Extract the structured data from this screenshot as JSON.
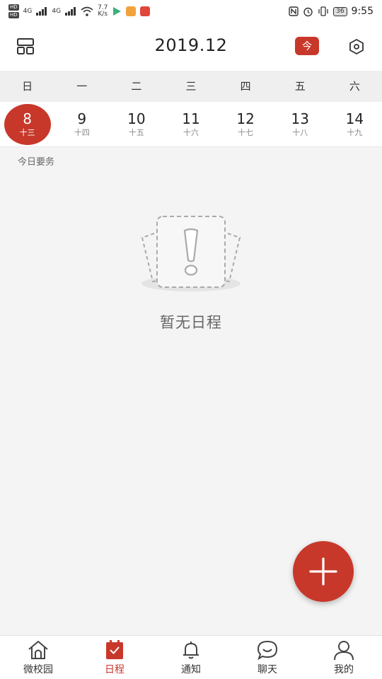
{
  "status_bar": {
    "hd_top": "HD",
    "hd_bottom": "HD",
    "net1": "4G",
    "net2": "4G",
    "speed_value": "7.7",
    "speed_unit": "K/s",
    "battery": "36",
    "time": "9:55"
  },
  "header": {
    "title": "2019.12",
    "today_label": "今"
  },
  "weekdays": [
    "日",
    "一",
    "二",
    "三",
    "四",
    "五",
    "六"
  ],
  "dates": [
    {
      "day": "8",
      "lunar": "十三",
      "selected": true
    },
    {
      "day": "9",
      "lunar": "十四",
      "selected": false
    },
    {
      "day": "10",
      "lunar": "十五",
      "selected": false
    },
    {
      "day": "11",
      "lunar": "十六",
      "selected": false
    },
    {
      "day": "12",
      "lunar": "十七",
      "selected": false
    },
    {
      "day": "13",
      "lunar": "十八",
      "selected": false
    },
    {
      "day": "14",
      "lunar": "十九",
      "selected": false
    }
  ],
  "main": {
    "section_label": "今日要务",
    "empty_text": "暂无日程"
  },
  "bottom_nav": [
    {
      "label": "微校园",
      "icon": "home-icon",
      "active": false
    },
    {
      "label": "日程",
      "icon": "calendar-check-icon",
      "active": true
    },
    {
      "label": "通知",
      "icon": "bell-icon",
      "active": false
    },
    {
      "label": "聊天",
      "icon": "chat-icon",
      "active": false
    },
    {
      "label": "我的",
      "icon": "user-icon",
      "active": false
    }
  ],
  "colors": {
    "accent": "#c8382a",
    "background": "#f4f4f4"
  }
}
